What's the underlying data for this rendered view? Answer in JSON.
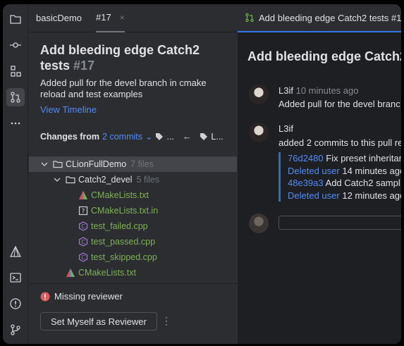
{
  "tabs": {
    "project": "basicDemo",
    "pr": "#17",
    "close": "×"
  },
  "pr": {
    "title": "Add bleeding edge Catch2 tests",
    "number": "#17",
    "description": "Added pull for the devel branch in cmake reload and test examples",
    "timeline_link": "View Timeline"
  },
  "changes": {
    "label": "Changes from",
    "commits": "2 commits",
    "more1": "...",
    "arrow": "←",
    "more2": "L..."
  },
  "tree": [
    {
      "name": "CLionFullDemo",
      "count": "7 files",
      "kind": "folder",
      "level": 0,
      "expanded": true
    },
    {
      "name": "Catch2_devel",
      "count": "5 files",
      "kind": "folder",
      "level": 1,
      "expanded": true
    },
    {
      "name": "CMakeLists.txt",
      "kind": "cmake",
      "level": 2
    },
    {
      "name": "CMakeLists.txt.in",
      "kind": "unknown",
      "level": 2
    },
    {
      "name": "test_failed.cpp",
      "kind": "cpp",
      "level": 2
    },
    {
      "name": "test_passed.cpp",
      "kind": "cpp",
      "level": 2
    },
    {
      "name": "test_skipped.cpp",
      "kind": "cpp",
      "level": 2
    },
    {
      "name": "CMakeLists.txt",
      "kind": "cmake",
      "level": 1
    }
  ],
  "review": {
    "missing": "Missing reviewer",
    "button": "Set Myself as Reviewer",
    "kebab": "⋮"
  },
  "right": {
    "tab_label": "Add bleeding edge Catch2 tests #1",
    "title": "Add bleeding edge Catch2",
    "comment1": {
      "author": "L3if",
      "time": "10 minutes ago",
      "text": "Added pull for the devel branc"
    },
    "comment2": {
      "author": "L3if",
      "text": "added 2 commits to this pull re"
    },
    "commits": [
      {
        "hash": "76d2480",
        "msg": "Fix preset inheritan",
        "author": "Deleted user",
        "time": "14 minutes ago"
      },
      {
        "hash": "48e39a3",
        "msg": "Add Catch2 sampl",
        "author": "Deleted user",
        "time": "12 minutes ago"
      }
    ]
  },
  "colors": {
    "accent": "#548af7",
    "green": "#7fb055",
    "error": "#db5c5c",
    "bg": "#2b2d30",
    "editor": "#1e1f22"
  }
}
